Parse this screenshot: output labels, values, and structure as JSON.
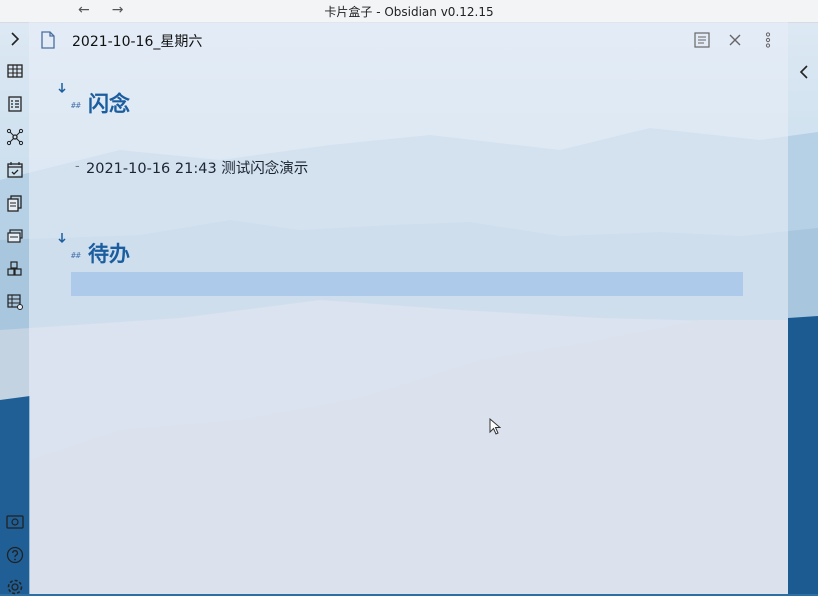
{
  "window": {
    "title": "卡片盒子 - Obsidian v0.12.15"
  },
  "nav": {
    "back": "←",
    "forward": "→"
  },
  "ribbon": {
    "icons": [
      "chevron-right-icon",
      "table-icon",
      "checklist-icon",
      "graph-icon",
      "calendar-check-icon",
      "copy-doc-icon",
      "cards-icon",
      "blocks-icon",
      "grid-settings-icon",
      "vault-icon",
      "help-icon",
      "settings-icon"
    ]
  },
  "pane": {
    "file_title": "2021-10-16_星期六",
    "sections": [
      {
        "mark": "##",
        "heading": "闪念",
        "items": [
          {
            "bullet": "-",
            "text": "2021-10-16 21:43 测试闪念演示"
          }
        ]
      },
      {
        "mark": "##",
        "heading": "待办",
        "items": []
      }
    ]
  },
  "colors": {
    "accent": "#1b5ea0",
    "selection": "#a9c8ea"
  }
}
